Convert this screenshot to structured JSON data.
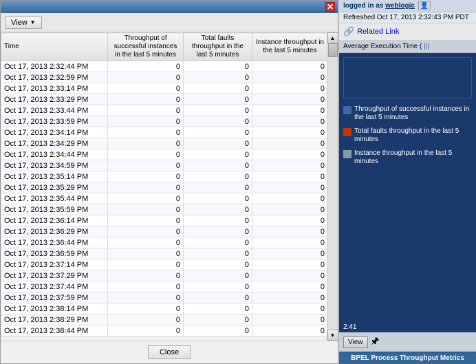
{
  "dialog": {
    "title": "BPEL Process Throughput Metrics",
    "close_label": "✕"
  },
  "toolbar": {
    "view_label": "View",
    "view_arrow": "▼"
  },
  "table": {
    "headers": {
      "time": "Time",
      "throughput": "Throughput of successful instances in the last 5 minutes",
      "faults": "Total faults throughput in the last 5 minutes",
      "instance": "Instance throughput in the last 5 minutes"
    },
    "rows": [
      {
        "time": "Oct 17, 2013 2:32:44 PM",
        "throughput": "0",
        "faults": "0",
        "instance": "0"
      },
      {
        "time": "Oct 17, 2013 2:32:59 PM",
        "throughput": "0",
        "faults": "0",
        "instance": "0"
      },
      {
        "time": "Oct 17, 2013 2:33:14 PM",
        "throughput": "0",
        "faults": "0",
        "instance": "0"
      },
      {
        "time": "Oct 17, 2013 2:33:29 PM",
        "throughput": "0",
        "faults": "0",
        "instance": "0"
      },
      {
        "time": "Oct 17, 2013 2:33:44 PM",
        "throughput": "0",
        "faults": "0",
        "instance": "0"
      },
      {
        "time": "Oct 17, 2013 2:33:59 PM",
        "throughput": "0",
        "faults": "0",
        "instance": "0"
      },
      {
        "time": "Oct 17, 2013 2:34:14 PM",
        "throughput": "0",
        "faults": "0",
        "instance": "0"
      },
      {
        "time": "Oct 17, 2013 2:34:29 PM",
        "throughput": "0",
        "faults": "0",
        "instance": "0"
      },
      {
        "time": "Oct 17, 2013 2:34:44 PM",
        "throughput": "0",
        "faults": "0",
        "instance": "0"
      },
      {
        "time": "Oct 17, 2013 2:34:59 PM",
        "throughput": "0",
        "faults": "0",
        "instance": "0"
      },
      {
        "time": "Oct 17, 2013 2:35:14 PM",
        "throughput": "0",
        "faults": "0",
        "instance": "0"
      },
      {
        "time": "Oct 17, 2013 2:35:29 PM",
        "throughput": "0",
        "faults": "0",
        "instance": "0"
      },
      {
        "time": "Oct 17, 2013 2:35:44 PM",
        "throughput": "0",
        "faults": "0",
        "instance": "0"
      },
      {
        "time": "Oct 17, 2013 2:35:59 PM",
        "throughput": "0",
        "faults": "0",
        "instance": "0"
      },
      {
        "time": "Oct 17, 2013 2:36:14 PM",
        "throughput": "0",
        "faults": "0",
        "instance": "0"
      },
      {
        "time": "Oct 17, 2013 2:36:29 PM",
        "throughput": "0",
        "faults": "0",
        "instance": "0"
      },
      {
        "time": "Oct 17, 2013 2:36:44 PM",
        "throughput": "0",
        "faults": "0",
        "instance": "0"
      },
      {
        "time": "Oct 17, 2013 2:36:59 PM",
        "throughput": "0",
        "faults": "0",
        "instance": "0"
      },
      {
        "time": "Oct 17, 2013 2:37:14 PM",
        "throughput": "0",
        "faults": "0",
        "instance": "0"
      },
      {
        "time": "Oct 17, 2013 2:37:29 PM",
        "throughput": "0",
        "faults": "0",
        "instance": "0"
      },
      {
        "time": "Oct 17, 2013 2:37:44 PM",
        "throughput": "0",
        "faults": "0",
        "instance": "0"
      },
      {
        "time": "Oct 17, 2013 2:37:59 PM",
        "throughput": "0",
        "faults": "0",
        "instance": "0"
      },
      {
        "time": "Oct 17, 2013 2:38:14 PM",
        "throughput": "0",
        "faults": "0",
        "instance": "0"
      },
      {
        "time": "Oct 17, 2013 2:38:29 PM",
        "throughput": "0",
        "faults": "0",
        "instance": "0"
      },
      {
        "time": "Oct 17, 2013 2:38:44 PM",
        "throughput": "0",
        "faults": "0",
        "instance": "0"
      }
    ]
  },
  "footer": {
    "close_label": "Close"
  },
  "right_panel": {
    "logged_in_as": "logged in as",
    "user": "weblogic",
    "refreshed": "Refreshed Oct 17, 2013 2:32:43 PM PDT",
    "related_link_label": "Related Link",
    "avg_exec_label": "Average Execution Time (",
    "timestamp_2241": "2:41",
    "view_label": "View",
    "bottom_title": "BPEL Process Throughput Metrics",
    "legend": [
      {
        "color": "blue",
        "text": "Throughput of successful instances in the last 5 minutes"
      },
      {
        "color": "red",
        "text": "Total faults throughput in the last 5 minutes"
      },
      {
        "color": "gray",
        "text": "Instance throughput in the last 5 minutes"
      }
    ]
  }
}
